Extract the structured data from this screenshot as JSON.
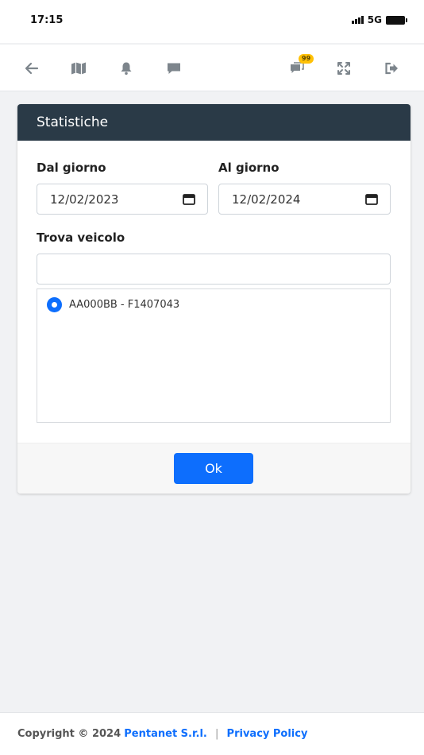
{
  "status_bar": {
    "time": "17:15",
    "network": "5G"
  },
  "toolbar": {
    "icons": [
      "arrow-left-icon",
      "map-icon",
      "bell-icon",
      "chat-icon",
      "chat-badge-icon",
      "expand-icon",
      "logout-icon"
    ],
    "chat_badge_count": "99"
  },
  "card": {
    "title": "Statistiche",
    "from_label": "Dal giorno",
    "from_value": "12/02/2023",
    "to_label": "Al giorno",
    "to_value": "12/02/2024",
    "vehicle_label": "Trova veicolo",
    "vehicle_search_value": "",
    "vehicles": [
      {
        "label": "AA000BB - F1407043",
        "selected": true
      }
    ],
    "ok_label": "Ok"
  },
  "footer": {
    "copyright": "Copyright © 2024",
    "company": "Pentanet S.r.l.",
    "separator": "|",
    "privacy": "Privacy Policy"
  },
  "colors": {
    "header_bg": "#2a3a47",
    "primary": "#0d6efd",
    "badge": "#ffc107",
    "toolbar_icon": "#7d858c"
  }
}
